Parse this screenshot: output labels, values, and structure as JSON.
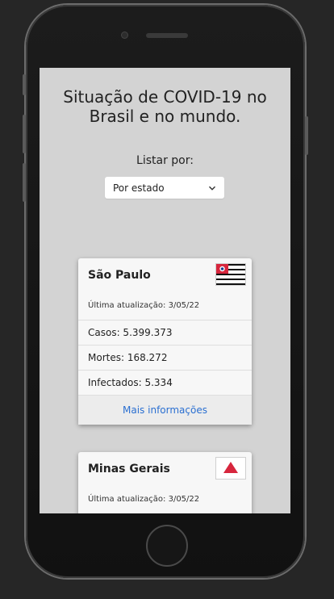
{
  "page": {
    "title": "Situação de COVID-19 no Brasil e no mundo.",
    "list_by_label": "Listar por:",
    "list_by_select": {
      "selected": "Por estado"
    }
  },
  "states": [
    {
      "name": "São Paulo",
      "last_update": "Última atualização: 3/05/22",
      "cases": "Casos: 5.399.373",
      "deaths": "Mortes: 168.272",
      "infected": "Infectados: 5.334",
      "more_info": "Mais informações",
      "flag_icon": "flag-sao-paulo-icon"
    },
    {
      "name": "Minas Gerais",
      "last_update": "Última atualização: 3/05/22",
      "flag_icon": "flag-minas-gerais-icon"
    }
  ],
  "colors": {
    "screen_bg": "#d3d3d3",
    "card_bg": "#f7f7f7",
    "link": "#2a6fd1",
    "device_bg": "#262626"
  }
}
